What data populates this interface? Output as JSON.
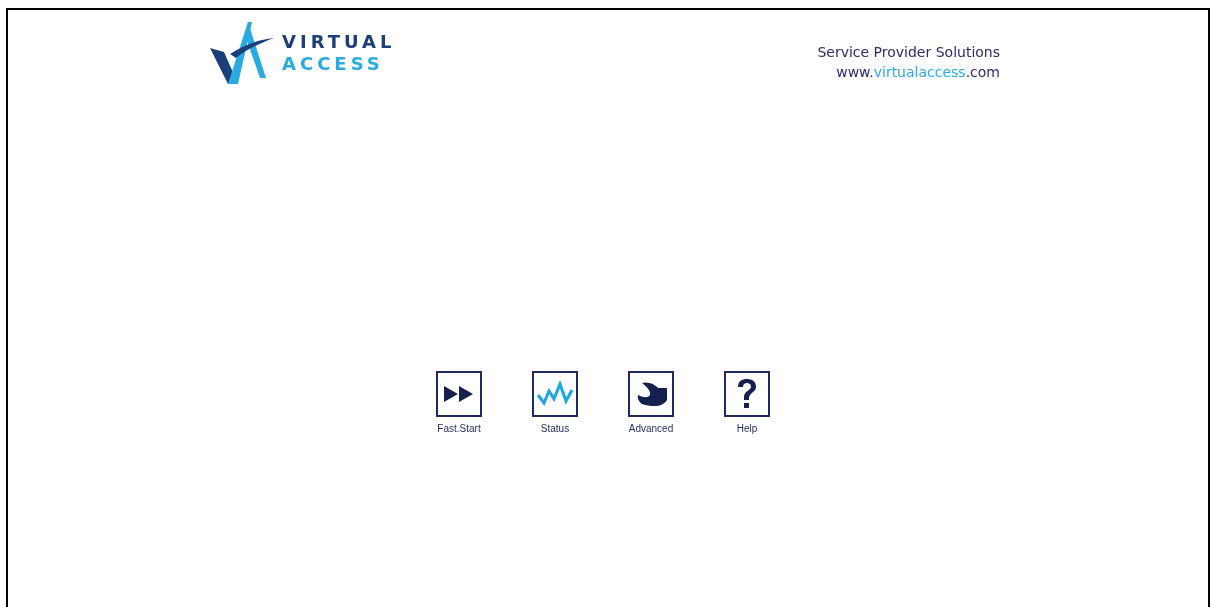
{
  "logo": {
    "line_1": "VIRTUAL",
    "line_2": "ACCESS"
  },
  "header": {
    "tagline": "Service Provider Solutions",
    "url_parts": [
      {
        "text": "www.",
        "highlight": false
      },
      {
        "text": "virtualaccess",
        "highlight": true
      },
      {
        "text": ".com",
        "highlight": false
      }
    ]
  },
  "menu": [
    {
      "kind": "fast-start",
      "label": "Fast.Start"
    },
    {
      "kind": "status",
      "label": "Status"
    },
    {
      "kind": "advanced",
      "label": "Advanced"
    },
    {
      "kind": "help",
      "label": "Help"
    }
  ]
}
